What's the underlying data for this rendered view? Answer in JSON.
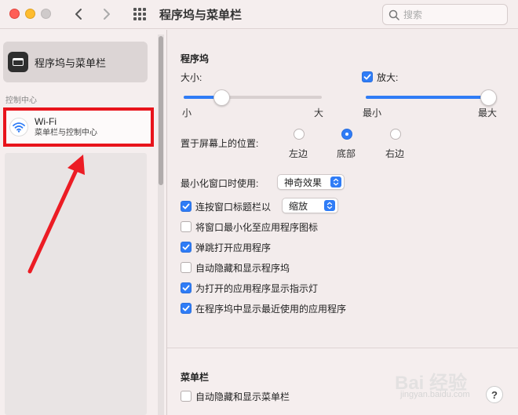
{
  "window": {
    "title": "程序坞与菜单栏"
  },
  "search": {
    "placeholder": "搜索"
  },
  "sidebar": {
    "selected_label": "程序坞与菜单栏",
    "section_label": "控制中心",
    "wifi": {
      "title": "Wi-Fi",
      "subtitle": "菜单栏与控制中心"
    }
  },
  "dock": {
    "section_title": "程序坞",
    "size": {
      "label": "大小:",
      "min_label": "小",
      "max_label": "大",
      "value": 0.27
    },
    "magnification": {
      "label": "放大:",
      "checked": true,
      "min_label": "最小",
      "max_label": "最大",
      "value": 1.0
    },
    "position": {
      "label": "置于屏幕上的位置:",
      "options": [
        "左边",
        "底部",
        "右边"
      ],
      "selected": "底部"
    },
    "minimize_effect": {
      "label": "最小化窗口时使用:",
      "value": "神奇效果"
    },
    "double_click": {
      "label": "连按窗口标题栏以",
      "value": "缩放",
      "checked": true
    },
    "checkboxes": [
      {
        "label": "将窗口最小化至应用程序图标",
        "checked": false
      },
      {
        "label": "弹跳打开应用程序",
        "checked": true
      },
      {
        "label": "自动隐藏和显示程序坞",
        "checked": false
      },
      {
        "label": "为打开的应用程序显示指示灯",
        "checked": true
      },
      {
        "label": "在程序坞中显示最近使用的应用程序",
        "checked": true
      }
    ]
  },
  "menubar": {
    "section_title": "菜单栏",
    "auto_hide": {
      "label": "自动隐藏和显示菜单栏",
      "checked": false
    }
  },
  "help": {
    "label": "?"
  },
  "watermark": {
    "text": "Bai 经验",
    "sub": "jingyan.baidu.com"
  },
  "colors": {
    "accent": "#2f7cf6",
    "highlight": "#e8131b"
  }
}
